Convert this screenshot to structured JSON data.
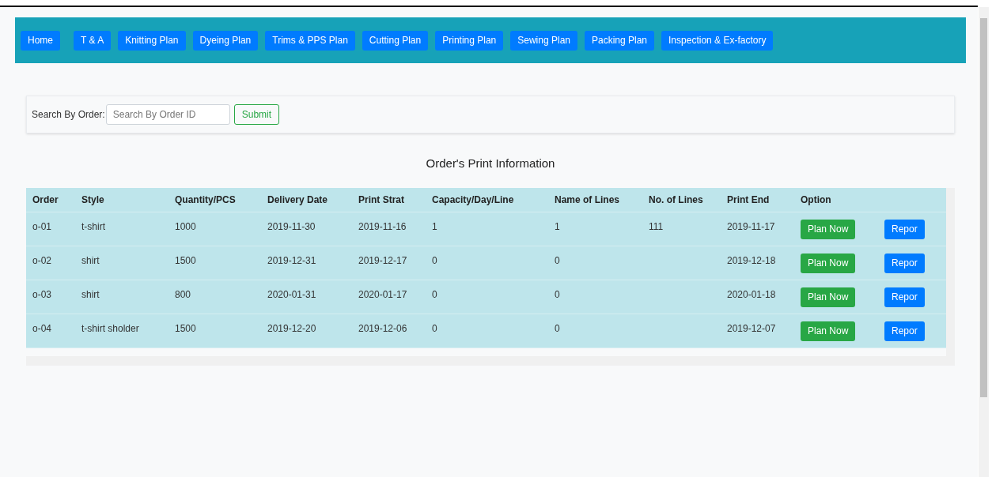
{
  "nav": [
    {
      "label": "Home"
    },
    {
      "label": "T & A"
    },
    {
      "label": "Knitting Plan"
    },
    {
      "label": "Dyeing Plan"
    },
    {
      "label": "Trims & PPS Plan"
    },
    {
      "label": "Cutting Plan"
    },
    {
      "label": "Printing Plan"
    },
    {
      "label": "Sewing Plan"
    },
    {
      "label": "Packing Plan"
    },
    {
      "label": "Inspection & Ex-factory"
    }
  ],
  "search": {
    "label": "Search By Order:",
    "placeholder": "Search By Order ID",
    "button": "Submit"
  },
  "title": "Order's Print Information",
  "table": {
    "columns": [
      "Order",
      "Style",
      "Quantity/PCS",
      "Delivery Date",
      "Print Strat",
      "Capacity/Day/Line",
      "Name of Lines",
      "No. of Lines",
      "Print End",
      "Option"
    ],
    "rows": [
      {
        "cells": [
          "o-01",
          "t-shirt",
          "1000",
          "2019-11-30",
          "2019-11-16",
          "1",
          "1",
          "111",
          "2019-11-17"
        ],
        "plan": "Plan Now",
        "report": "Repor"
      },
      {
        "cells": [
          "o-02",
          "shirt",
          "1500",
          "2019-12-31",
          "2019-12-17",
          "0",
          "0",
          null,
          "2019-12-18"
        ],
        "plan": "Plan Now",
        "report": "Repor"
      },
      {
        "cells": [
          "o-03",
          "shirt",
          "800",
          "2020-01-31",
          "2020-01-17",
          "0",
          "0",
          null,
          "2020-01-18"
        ],
        "plan": "Plan Now",
        "report": "Repor"
      },
      {
        "cells": [
          "o-04",
          "t-shirt sholder",
          "1500",
          "2019-12-20",
          "2019-12-06",
          "0",
          "0",
          null,
          "2019-12-07"
        ],
        "plan": "Plan Now",
        "report": "Repor"
      }
    ]
  }
}
